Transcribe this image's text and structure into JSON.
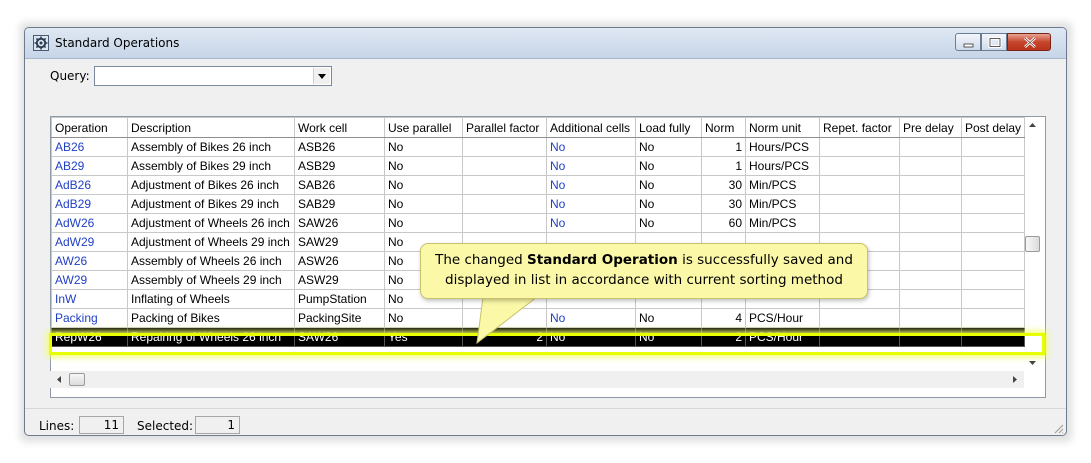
{
  "window": {
    "title": "Standard Operations"
  },
  "query": {
    "label": "Query:",
    "value": ""
  },
  "table": {
    "columns": [
      "Operation",
      "Description",
      "Work cell",
      "Use parallel",
      "Parallel factor",
      "Additional cells",
      "Load fully",
      "Norm",
      "Norm unit",
      "Repet. factor",
      "Pre delay",
      "Post delay"
    ],
    "rows": [
      [
        "AB26",
        "Assembly of Bikes 26 inch",
        "ASB26",
        "No",
        "",
        "No",
        "No",
        "1",
        "Hours/PCS",
        "",
        "",
        ""
      ],
      [
        "AB29",
        "Assembly of Bikes 29 inch",
        "ASB29",
        "No",
        "",
        "No",
        "No",
        "1",
        "Hours/PCS",
        "",
        "",
        ""
      ],
      [
        "AdB26",
        "Adjustment of Bikes 26 inch",
        "SAB26",
        "No",
        "",
        "No",
        "No",
        "30",
        "Min/PCS",
        "",
        "",
        ""
      ],
      [
        "AdB29",
        "Adjustment of Bikes 29 inch",
        "SAB29",
        "No",
        "",
        "No",
        "No",
        "30",
        "Min/PCS",
        "",
        "",
        ""
      ],
      [
        "AdW26",
        "Adjustment of Wheels 26 inch",
        "SAW26",
        "No",
        "",
        "No",
        "No",
        "60",
        "Min/PCS",
        "",
        "",
        ""
      ],
      [
        "AdW29",
        "Adjustment of Wheels 29 inch",
        "SAW29",
        "No",
        "",
        "",
        "",
        "",
        "",
        "",
        "",
        ""
      ],
      [
        "AW26",
        "Assembly of Wheels 26 inch",
        "ASW26",
        "No",
        "",
        "",
        "",
        "",
        "",
        "",
        "",
        ""
      ],
      [
        "AW29",
        "Assembly of Wheels 29 inch",
        "ASW29",
        "No",
        "",
        "",
        "",
        "",
        "",
        "",
        "",
        ""
      ],
      [
        "InW",
        "Inflating of Wheels",
        "PumpStation",
        "No",
        "",
        "",
        "",
        "",
        "",
        "",
        "",
        ""
      ],
      [
        "Packing",
        "Packing of Bikes",
        "PackingSite",
        "No",
        "",
        "No",
        "No",
        "4",
        "PCS/Hour",
        "",
        "",
        ""
      ],
      [
        "RepW26",
        "Repairing of Wheels 26 inch",
        "SAW26",
        "Yes",
        "2",
        "No",
        "No",
        "2",
        "PCS/Hour",
        "",
        "",
        ""
      ]
    ],
    "selected_index": 10
  },
  "status": {
    "lines_label": "Lines:",
    "lines_value": "11",
    "selected_label": "Selected:",
    "selected_value": "1"
  },
  "callout": {
    "line1_pre": "The changed ",
    "line1_bold": "Standard Operation",
    "line1_post": " is successfully saved and",
    "line2": "displayed in list in accordance with current sorting method"
  },
  "colors": {
    "link": "#1f3fc5",
    "selection_bg": "#000000",
    "selection_glow": "#e7ff00",
    "callout_bg": "#fbf9a8"
  },
  "icons": [
    "app-gear-icon",
    "minimize-icon",
    "maximize-icon",
    "close-icon",
    "dropdown-arrow-icon",
    "scroll-up-icon",
    "scroll-down-icon",
    "scroll-left-icon",
    "scroll-right-icon",
    "resize-grip-icon"
  ]
}
